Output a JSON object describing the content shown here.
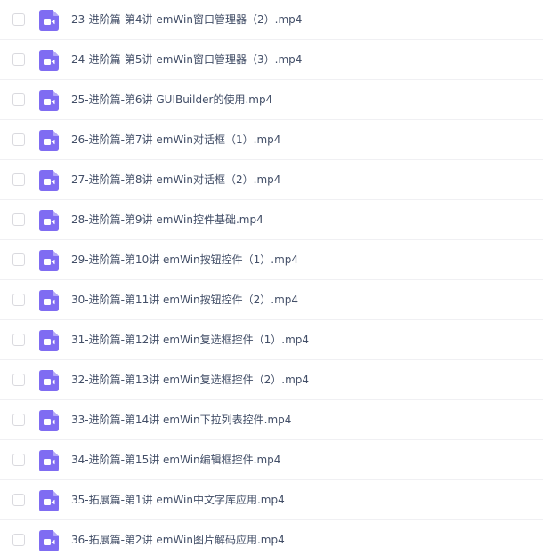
{
  "file_list": {
    "icon": "video-file-icon",
    "icon_color": "#7f6cf2",
    "items": [
      {
        "name": "23-进阶篇-第4讲 emWin窗口管理器（2）.mp4"
      },
      {
        "name": "24-进阶篇-第5讲 emWin窗口管理器（3）.mp4"
      },
      {
        "name": "25-进阶篇-第6讲 GUIBuilder的使用.mp4"
      },
      {
        "name": "26-进阶篇-第7讲 emWin对话框（1）.mp4"
      },
      {
        "name": "27-进阶篇-第8讲 emWin对话框（2）.mp4"
      },
      {
        "name": "28-进阶篇-第9讲 emWin控件基础.mp4"
      },
      {
        "name": "29-进阶篇-第10讲 emWin按钮控件（1）.mp4"
      },
      {
        "name": "30-进阶篇-第11讲 emWin按钮控件（2）.mp4"
      },
      {
        "name": "31-进阶篇-第12讲 emWin复选框控件（1）.mp4"
      },
      {
        "name": "32-进阶篇-第13讲 emWin复选框控件（2）.mp4"
      },
      {
        "name": "33-进阶篇-第14讲 emWin下拉列表控件.mp4"
      },
      {
        "name": "34-进阶篇-第15讲 emWin编辑框控件.mp4"
      },
      {
        "name": "35-拓展篇-第1讲 emWin中文字库应用.mp4"
      },
      {
        "name": "36-拓展篇-第2讲 emWin图片解码应用.mp4"
      }
    ]
  }
}
